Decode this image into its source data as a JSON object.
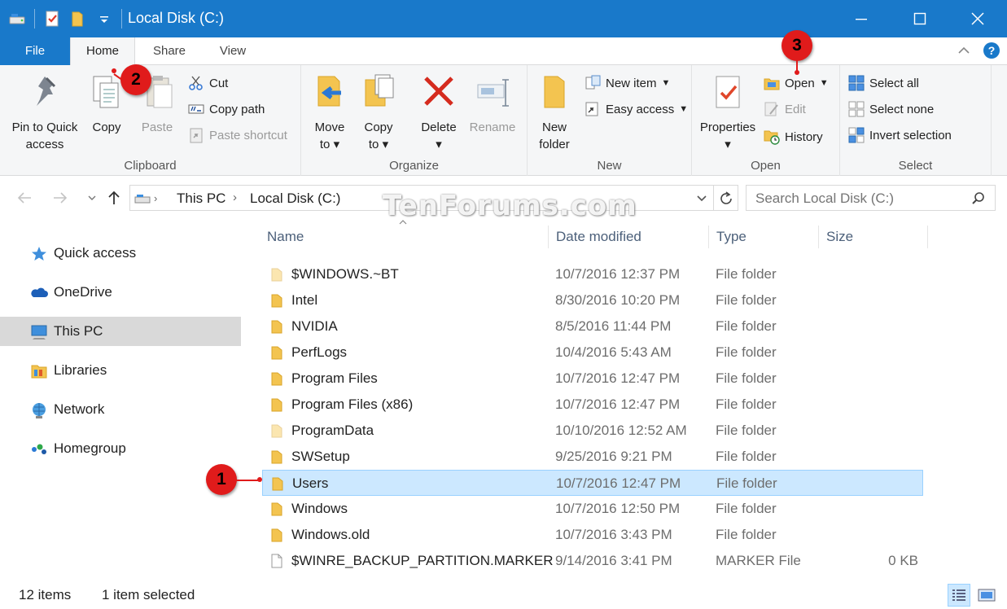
{
  "window": {
    "title": "Local Disk (C:)",
    "accent_color": "#1979ca"
  },
  "ribbon_tabs": [
    "File",
    "Home",
    "Share",
    "View"
  ],
  "ribbon": {
    "clipboard": {
      "label": "Clipboard",
      "pin": "Pin to Quick",
      "pin2": "access",
      "copy": "Copy",
      "paste": "Paste",
      "cut": "Cut",
      "copy_path": "Copy path",
      "paste_shortcut": "Paste shortcut"
    },
    "organize": {
      "label": "Organize",
      "move": "Move",
      "move2": "to",
      "copy": "Copy",
      "copy2": "to",
      "delete": "Delete",
      "rename": "Rename"
    },
    "new": {
      "label": "New",
      "new_folder": "New",
      "new_folder2": "folder",
      "new_item": "New item",
      "easy_access": "Easy access"
    },
    "open": {
      "label": "Open",
      "properties": "Properties",
      "open": "Open",
      "edit": "Edit",
      "history": "History"
    },
    "select": {
      "label": "Select",
      "select_all": "Select all",
      "select_none": "Select none",
      "invert": "Invert selection"
    }
  },
  "address": {
    "crumbs": [
      "This PC",
      "Local Disk (C:)"
    ],
    "search_placeholder": "Search Local Disk (C:)"
  },
  "watermark": "TenForums.com",
  "nav_pane": [
    {
      "label": "Quick access",
      "icon": "star-icon"
    },
    {
      "label": "OneDrive",
      "icon": "cloud-icon"
    },
    {
      "label": "This PC",
      "icon": "computer-icon",
      "selected": true
    },
    {
      "label": "Libraries",
      "icon": "libraries-icon"
    },
    {
      "label": "Network",
      "icon": "network-icon"
    },
    {
      "label": "Homegroup",
      "icon": "homegroup-icon"
    }
  ],
  "columns": {
    "name": "Name",
    "date": "Date modified",
    "type": "Type",
    "size": "Size"
  },
  "files": [
    {
      "name": "$WINDOWS.~BT",
      "date": "10/7/2016 12:37 PM",
      "type": "File folder",
      "size": "",
      "kind": "folder-faded"
    },
    {
      "name": "Intel",
      "date": "8/30/2016 10:20 PM",
      "type": "File folder",
      "size": "",
      "kind": "folder"
    },
    {
      "name": "NVIDIA",
      "date": "8/5/2016 11:44 PM",
      "type": "File folder",
      "size": "",
      "kind": "folder"
    },
    {
      "name": "PerfLogs",
      "date": "10/4/2016 5:43 AM",
      "type": "File folder",
      "size": "",
      "kind": "folder"
    },
    {
      "name": "Program Files",
      "date": "10/7/2016 12:47 PM",
      "type": "File folder",
      "size": "",
      "kind": "folder"
    },
    {
      "name": "Program Files (x86)",
      "date": "10/7/2016 12:47 PM",
      "type": "File folder",
      "size": "",
      "kind": "folder"
    },
    {
      "name": "ProgramData",
      "date": "10/10/2016 12:52 AM",
      "type": "File folder",
      "size": "",
      "kind": "folder-faded"
    },
    {
      "name": "SWSetup",
      "date": "9/25/2016 9:21 PM",
      "type": "File folder",
      "size": "",
      "kind": "folder"
    },
    {
      "name": "Users",
      "date": "10/7/2016 12:47 PM",
      "type": "File folder",
      "size": "",
      "kind": "folder",
      "selected": true
    },
    {
      "name": "Windows",
      "date": "10/7/2016 12:50 PM",
      "type": "File folder",
      "size": "",
      "kind": "folder"
    },
    {
      "name": "Windows.old",
      "date": "10/7/2016 3:43 PM",
      "type": "File folder",
      "size": "",
      "kind": "folder"
    },
    {
      "name": "$WINRE_BACKUP_PARTITION.MARKER",
      "date": "9/14/2016 3:41 PM",
      "type": "MARKER File",
      "size": "0 KB",
      "kind": "file"
    }
  ],
  "status": {
    "items": "12 items",
    "selected": "1 item selected"
  },
  "callouts": [
    "1",
    "2",
    "3"
  ]
}
